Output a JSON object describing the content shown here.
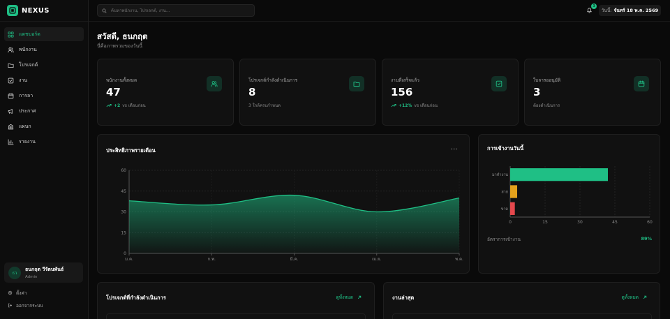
{
  "brand": {
    "name": "NEXUS"
  },
  "nav": {
    "items": [
      {
        "label": "แดชบอร์ด",
        "icon": "dashboard-icon"
      },
      {
        "label": "พนักงาน",
        "icon": "users-icon"
      },
      {
        "label": "โปรเจกต์",
        "icon": "folder-icon"
      },
      {
        "label": "งาน",
        "icon": "checkbox-icon"
      },
      {
        "label": "การลา",
        "icon": "calendar-icon"
      },
      {
        "label": "ประกาศ",
        "icon": "megaphone-icon"
      },
      {
        "label": "แผนก",
        "icon": "building-icon"
      },
      {
        "label": "รายงาน",
        "icon": "bar-chart-icon"
      }
    ],
    "active_index": 0
  },
  "user": {
    "initials": "ธว",
    "name": "ธนกฤต วีรัตนพันธ์",
    "role": "Admin"
  },
  "side_links": {
    "settings": "ตั้งค่า",
    "logout": "ออกจากระบบ"
  },
  "search": {
    "placeholder": "ค้นหาพนักงาน, โปรเจกต์, งาน..."
  },
  "notifications": {
    "count": "3"
  },
  "date": {
    "label": "วันนี้:",
    "value": "จันทร์ 18 พ.ค. 2569"
  },
  "greeting": {
    "title": "สวัสดี, ธนกฤต",
    "subtitle": "นี่คือภาพรวมของวันนี้"
  },
  "stats": [
    {
      "label": "พนักงานทั้งหมด",
      "value": "47",
      "delta": "+2",
      "sub": "vs เดือนก่อน",
      "icon": "users-icon"
    },
    {
      "label": "โปรเจกต์กำลังดำเนินการ",
      "value": "8",
      "delta": "",
      "sub": "3 ใกล้ครบกำหนด",
      "icon": "folder-icon"
    },
    {
      "label": "งานที่เสร็จแล้ว",
      "value": "156",
      "delta": "+12%",
      "sub": "vs เดือนก่อน",
      "icon": "checkbox-icon"
    },
    {
      "label": "ใบลารออนุมัติ",
      "value": "3",
      "delta": "",
      "sub": "ต้องดำเนินการ",
      "icon": "calendar-icon"
    }
  ],
  "performance": {
    "title": "ประสิทธิภาพรายเดือน",
    "more": "..."
  },
  "attendance": {
    "title": "การเข้างานวันนี้",
    "rate_label": "อัตราการเข้างาน",
    "rate_value": "89%"
  },
  "projects_panel": {
    "title": "โปรเจกต์ที่กำลังดำเนินการ",
    "view_all": "ดูทั้งหมด"
  },
  "tasks_panel": {
    "title": "งานล่าสุด",
    "view_all": "ดูทั้งหมด"
  },
  "colors": {
    "accent": "#1fbf85",
    "late": "#e5a21c",
    "absent": "#e5484d"
  },
  "chart_data": [
    {
      "type": "area",
      "title": "ประสิทธิภาพรายเดือน",
      "categories": [
        "ม.ค.",
        "ก.พ.",
        "มี.ค.",
        "เม.ย.",
        "พ.ค."
      ],
      "values": [
        38,
        35,
        42,
        30,
        40
      ],
      "ylim": [
        0,
        60
      ],
      "yticks": [
        0,
        15,
        30,
        45,
        60
      ],
      "grid": true
    },
    {
      "type": "bar",
      "orientation": "horizontal",
      "title": "การเข้างานวันนี้",
      "categories": [
        "มาทำงาน",
        "สาย",
        "ขาด"
      ],
      "values": [
        42,
        3,
        2
      ],
      "xlim": [
        0,
        60
      ],
      "xticks": [
        0,
        15,
        30,
        45,
        60
      ]
    }
  ]
}
